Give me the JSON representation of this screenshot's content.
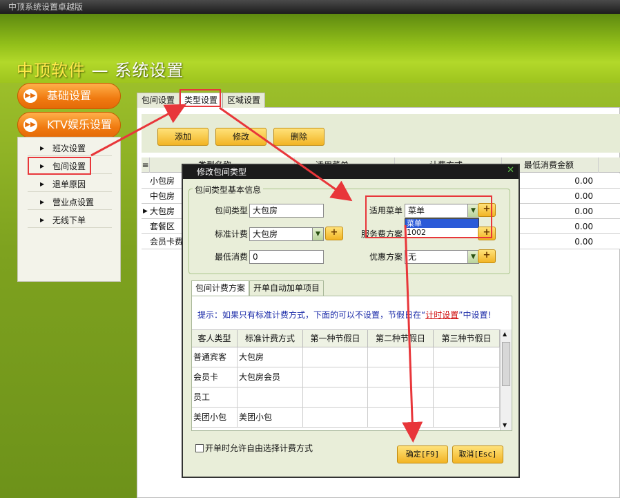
{
  "window_title": "中顶系统设置卓越版",
  "banner": {
    "brand": "中顶软件",
    "sep": " — ",
    "title": "系统设置"
  },
  "nav": {
    "basic": "基础设置",
    "ktv": "KTV娱乐设置",
    "items": [
      {
        "label": "班次设置"
      },
      {
        "label": "包间设置"
      },
      {
        "label": "退单原因"
      },
      {
        "label": "营业点设置"
      },
      {
        "label": "无线下单"
      }
    ]
  },
  "tabs": [
    "包间设置",
    "类型设置",
    "区域设置"
  ],
  "toolbar": {
    "add": "添加",
    "edit": "修改",
    "delete": "删除"
  },
  "table": {
    "headers": [
      "类型名称",
      "适用菜单",
      "计费方式",
      "最低消费金额"
    ],
    "rows": [
      {
        "name": "小包房",
        "amount": "0.00"
      },
      {
        "name": "中包房",
        "amount": "0.00"
      },
      {
        "name": "大包房",
        "amount": "0.00"
      },
      {
        "name": "套餐区",
        "amount": "0.00"
      },
      {
        "name": "会员卡费",
        "amount": "0.00"
      }
    ]
  },
  "dialog": {
    "title": "修改包间类型",
    "group_title": "包间类型基本信息",
    "fields": {
      "room_type_label": "包间类型",
      "room_type_value": "大包房",
      "menu_label": "适用菜单",
      "menu_value": "菜单",
      "std_label": "标准计费",
      "std_value": "大包房",
      "service_label": "服务费方案",
      "service_value": "无",
      "min_label": "最低消费",
      "min_value": "0",
      "discount_label": "优惠方案",
      "discount_value": "无"
    },
    "dropdown_options": [
      "菜单",
      "1002"
    ],
    "inner_tabs": [
      "包间计费方案",
      "开单自动加单项目"
    ],
    "hint_prefix": "提示：如果只有标准计费方式，下面的可以不设置，节假日在“",
    "hint_link": "计时设置",
    "hint_suffix": "”中设置!",
    "grid_headers": [
      "客人类型",
      "标准计费方式",
      "第一种节假日",
      "第二种节假日",
      "第三种节假日"
    ],
    "grid_rows": [
      {
        "type": "普通宾客",
        "std": "大包房"
      },
      {
        "type": "会员卡",
        "std": "大包房会员"
      },
      {
        "type": "员工",
        "std": ""
      },
      {
        "type": "美团小包",
        "std": "美团小包"
      }
    ],
    "checkbox_label": "开单时允许自由选择计费方式",
    "ok": "确定[F9]",
    "cancel": "取消[Esc]"
  },
  "colors": {
    "accent_orange": "#f07a10",
    "highlight_red": "#e8363a",
    "banner_green": "#93c01a"
  }
}
